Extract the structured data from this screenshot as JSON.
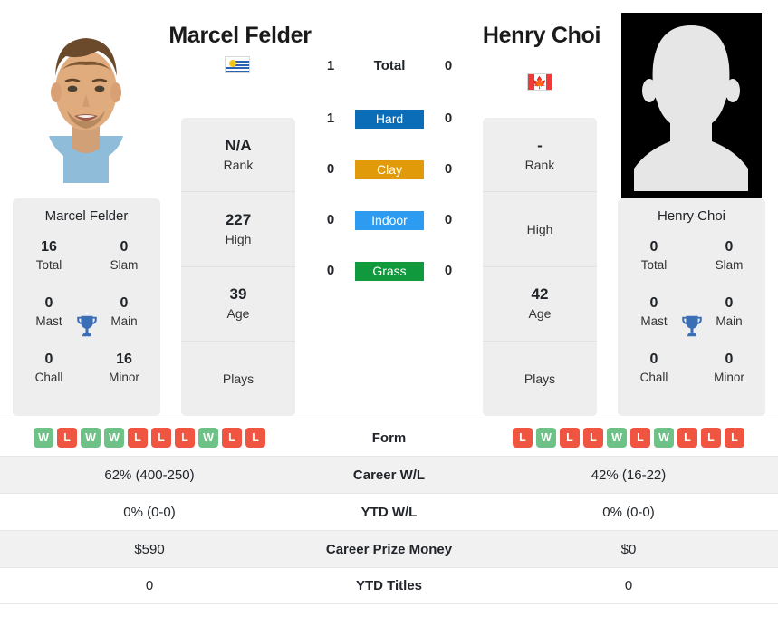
{
  "players": {
    "left": {
      "name": "Marcel Felder",
      "flag": "uruguay-flag",
      "photo": "player-photo",
      "rank": "N/A",
      "rank_label": "Rank",
      "high": "227",
      "high_label": "High",
      "age": "39",
      "age_label": "Age",
      "plays": "",
      "plays_label": "Plays",
      "titles": {
        "card_name": "Marcel Felder",
        "total": "16",
        "total_label": "Total",
        "slam": "0",
        "slam_label": "Slam",
        "mast": "0",
        "mast_label": "Mast",
        "main": "0",
        "main_label": "Main",
        "chall": "0",
        "chall_label": "Chall",
        "minor": "16",
        "minor_label": "Minor"
      },
      "form": [
        "W",
        "L",
        "W",
        "W",
        "L",
        "L",
        "L",
        "W",
        "L",
        "L"
      ],
      "career_wl": "62% (400-250)",
      "ytd_wl": "0% (0-0)",
      "career_prize_money": "$590",
      "ytd_titles": "0"
    },
    "right": {
      "name": "Henry Choi",
      "flag": "canada-flag",
      "photo": "player-silhouette-placeholder",
      "rank": "-",
      "rank_label": "Rank",
      "high": "",
      "high_label": "High",
      "age": "42",
      "age_label": "Age",
      "plays": "",
      "plays_label": "Plays",
      "titles": {
        "card_name": "Henry Choi",
        "total": "0",
        "total_label": "Total",
        "slam": "0",
        "slam_label": "Slam",
        "mast": "0",
        "mast_label": "Mast",
        "main": "0",
        "main_label": "Main",
        "chall": "0",
        "chall_label": "Chall",
        "minor": "0",
        "minor_label": "Minor"
      },
      "form": [
        "L",
        "W",
        "L",
        "L",
        "W",
        "L",
        "W",
        "L",
        "L",
        "L"
      ],
      "career_wl": "42% (16-22)",
      "ytd_wl": "0% (0-0)",
      "career_prize_money": "$0",
      "ytd_titles": "0"
    }
  },
  "head_to_head": [
    {
      "label": "Total",
      "left": "1",
      "right": "0",
      "style": "plain",
      "color": ""
    },
    {
      "label": "Hard",
      "left": "1",
      "right": "0",
      "style": "badge",
      "color": "#0b6cb8"
    },
    {
      "label": "Clay",
      "left": "0",
      "right": "0",
      "style": "badge",
      "color": "#e09a0a"
    },
    {
      "label": "Indoor",
      "left": "0",
      "right": "0",
      "style": "badge",
      "color": "#2c9bf0"
    },
    {
      "label": "Grass",
      "left": "0",
      "right": "0",
      "style": "badge",
      "color": "#119a3d"
    }
  ],
  "stats_table": {
    "rows": [
      {
        "label": "Form",
        "left": "",
        "right": "",
        "type": "form"
      },
      {
        "label": "Career W/L",
        "left": "62% (400-250)",
        "right": "42% (16-22)",
        "type": "text"
      },
      {
        "label": "YTD W/L",
        "left": "0% (0-0)",
        "right": "0% (0-0)",
        "type": "text"
      },
      {
        "label": "Career Prize Money",
        "left": "$590",
        "right": "$0",
        "type": "text"
      },
      {
        "label": "YTD Titles",
        "left": "0",
        "right": "0",
        "type": "text"
      }
    ]
  },
  "colors": {
    "win": "#6fc287",
    "loss": "#f05542",
    "card_bg": "#eeeeee",
    "row_shade": "#f1f1f1",
    "trophy": "#3b6eb5"
  }
}
